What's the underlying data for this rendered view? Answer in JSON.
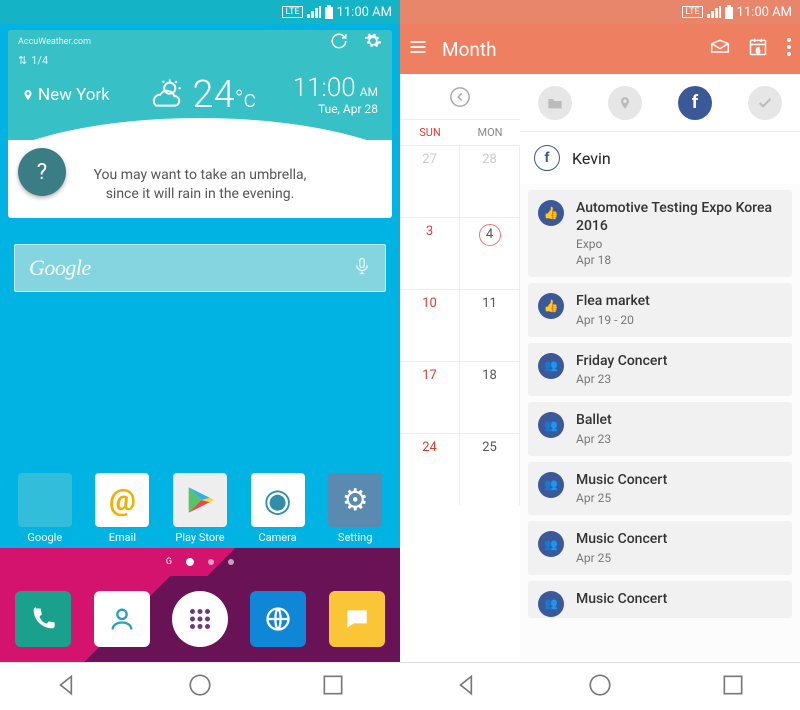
{
  "status": {
    "time": "11:00 AM",
    "network": "LTE"
  },
  "left": {
    "weather": {
      "source": "AccuWeather.com",
      "pager": "1/4",
      "location": "New York",
      "temp": "24",
      "temp_unit": "°c",
      "time": "11:00",
      "ampm": "AM",
      "date": "Tue, Apr 28",
      "message_l1": "You may want to take an umbrella,",
      "message_l2": "since it will rain in the evening.",
      "help": "?"
    },
    "search": {
      "label": "Google"
    },
    "apps": [
      {
        "label": "Google"
      },
      {
        "label": "Email"
      },
      {
        "label": "Play Store"
      },
      {
        "label": "Camera"
      },
      {
        "label": "Setting"
      }
    ],
    "dots": {
      "g": "G"
    }
  },
  "right": {
    "toolbar": {
      "title": "Month"
    },
    "cal": {
      "sun": "SUN",
      "mon": "MON",
      "rows": [
        {
          "s": "27",
          "m": "28",
          "gray": true
        },
        {
          "s": "3",
          "m": "4",
          "today": true
        },
        {
          "s": "10",
          "m": "11"
        },
        {
          "s": "17",
          "m": "18"
        },
        {
          "s": "24",
          "m": "25"
        }
      ]
    },
    "profile": {
      "name": "Kevin"
    },
    "events": [
      {
        "icon": "like",
        "title": "Automotive Testing Expo Korea 2016",
        "sub1": "Expo",
        "sub2": "Apr 18"
      },
      {
        "icon": "like",
        "title": "Flea market",
        "sub1": "Apr 19 - 20"
      },
      {
        "icon": "group",
        "title": "Friday Concert",
        "sub1": "Apr 23"
      },
      {
        "icon": "group",
        "title": "Ballet",
        "sub1": "Apr 23"
      },
      {
        "icon": "group",
        "title": "Music Concert",
        "sub1": "Apr 25"
      },
      {
        "icon": "group",
        "title": "Music Concert",
        "sub1": "Apr 25"
      },
      {
        "icon": "group",
        "title": "Music Concert",
        "sub1": ""
      }
    ]
  }
}
